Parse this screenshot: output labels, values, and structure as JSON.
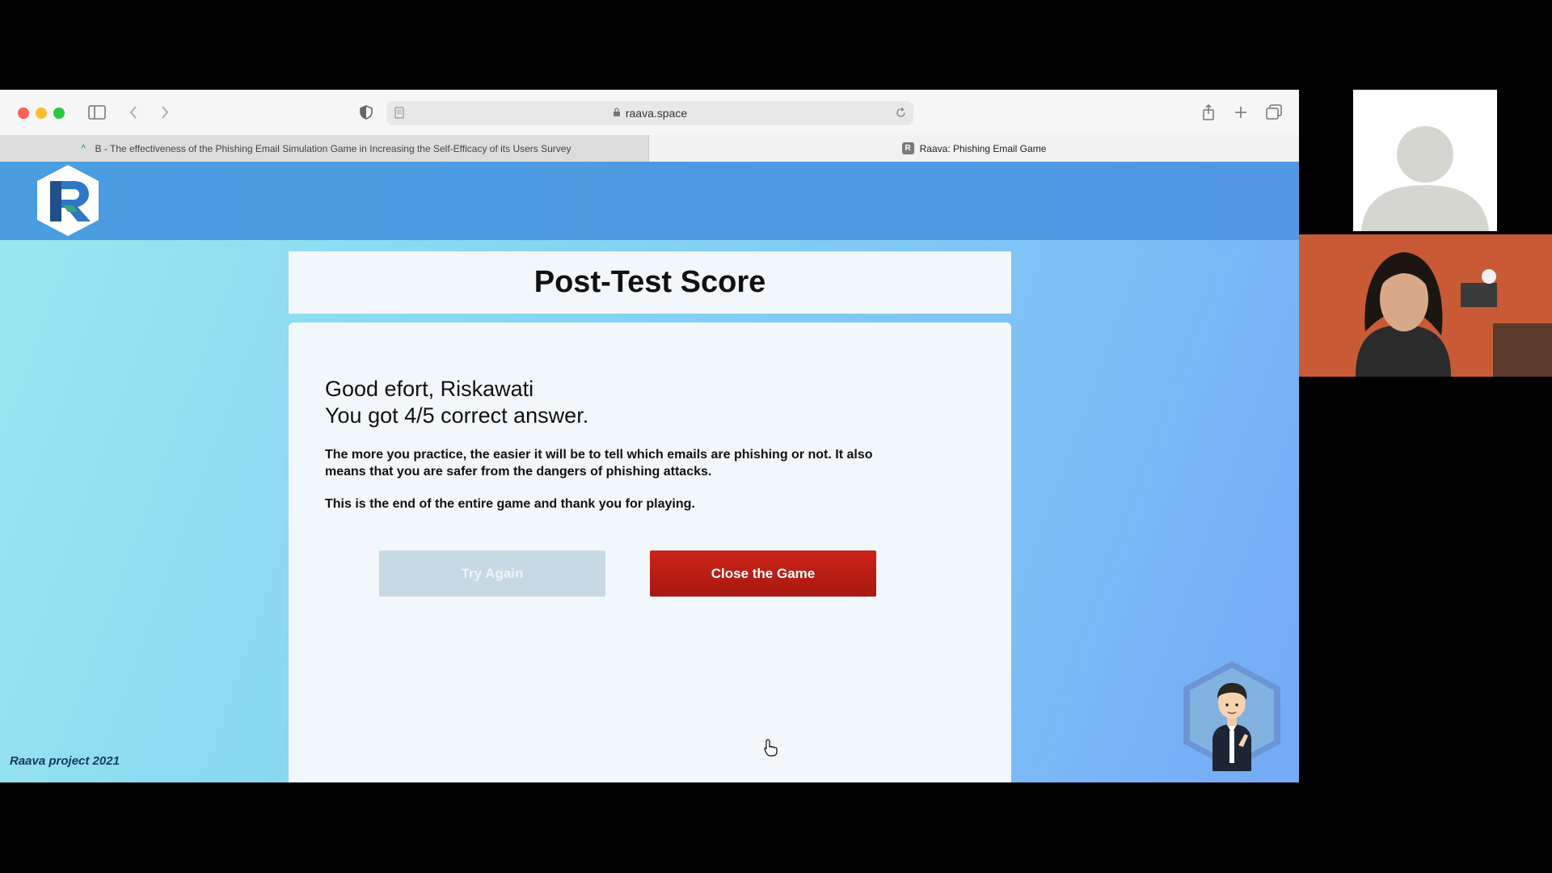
{
  "browser": {
    "url": "raava.space",
    "tabs": [
      {
        "label": "B - The effectiveness of the Phishing Email Simulation Game in Increasing the Self-Efficacy of its Users Survey",
        "favicon": "survey-icon"
      },
      {
        "label": "Raava: Phishing Email Game",
        "favicon": "raava-icon"
      }
    ]
  },
  "page": {
    "title": "Post-Test Score",
    "greeting": "Good efort, Riskawati",
    "score_line": "You got 4/5 correct answer.",
    "message": "The more you practice, the easier it will be to tell which emails are phishing or not. It also means that you are safer from the dangers of phishing attacks.",
    "end_message": "This is the end of the entire game and thank you for playing.",
    "try_again_label": "Try Again",
    "close_game_label": "Close the Game",
    "footer": "Raava project 2021"
  },
  "colors": {
    "header": "#4a9de1",
    "close_button": "#c0221a",
    "try_again_button": "#c7d9e3",
    "card": "#f2f7fc"
  }
}
